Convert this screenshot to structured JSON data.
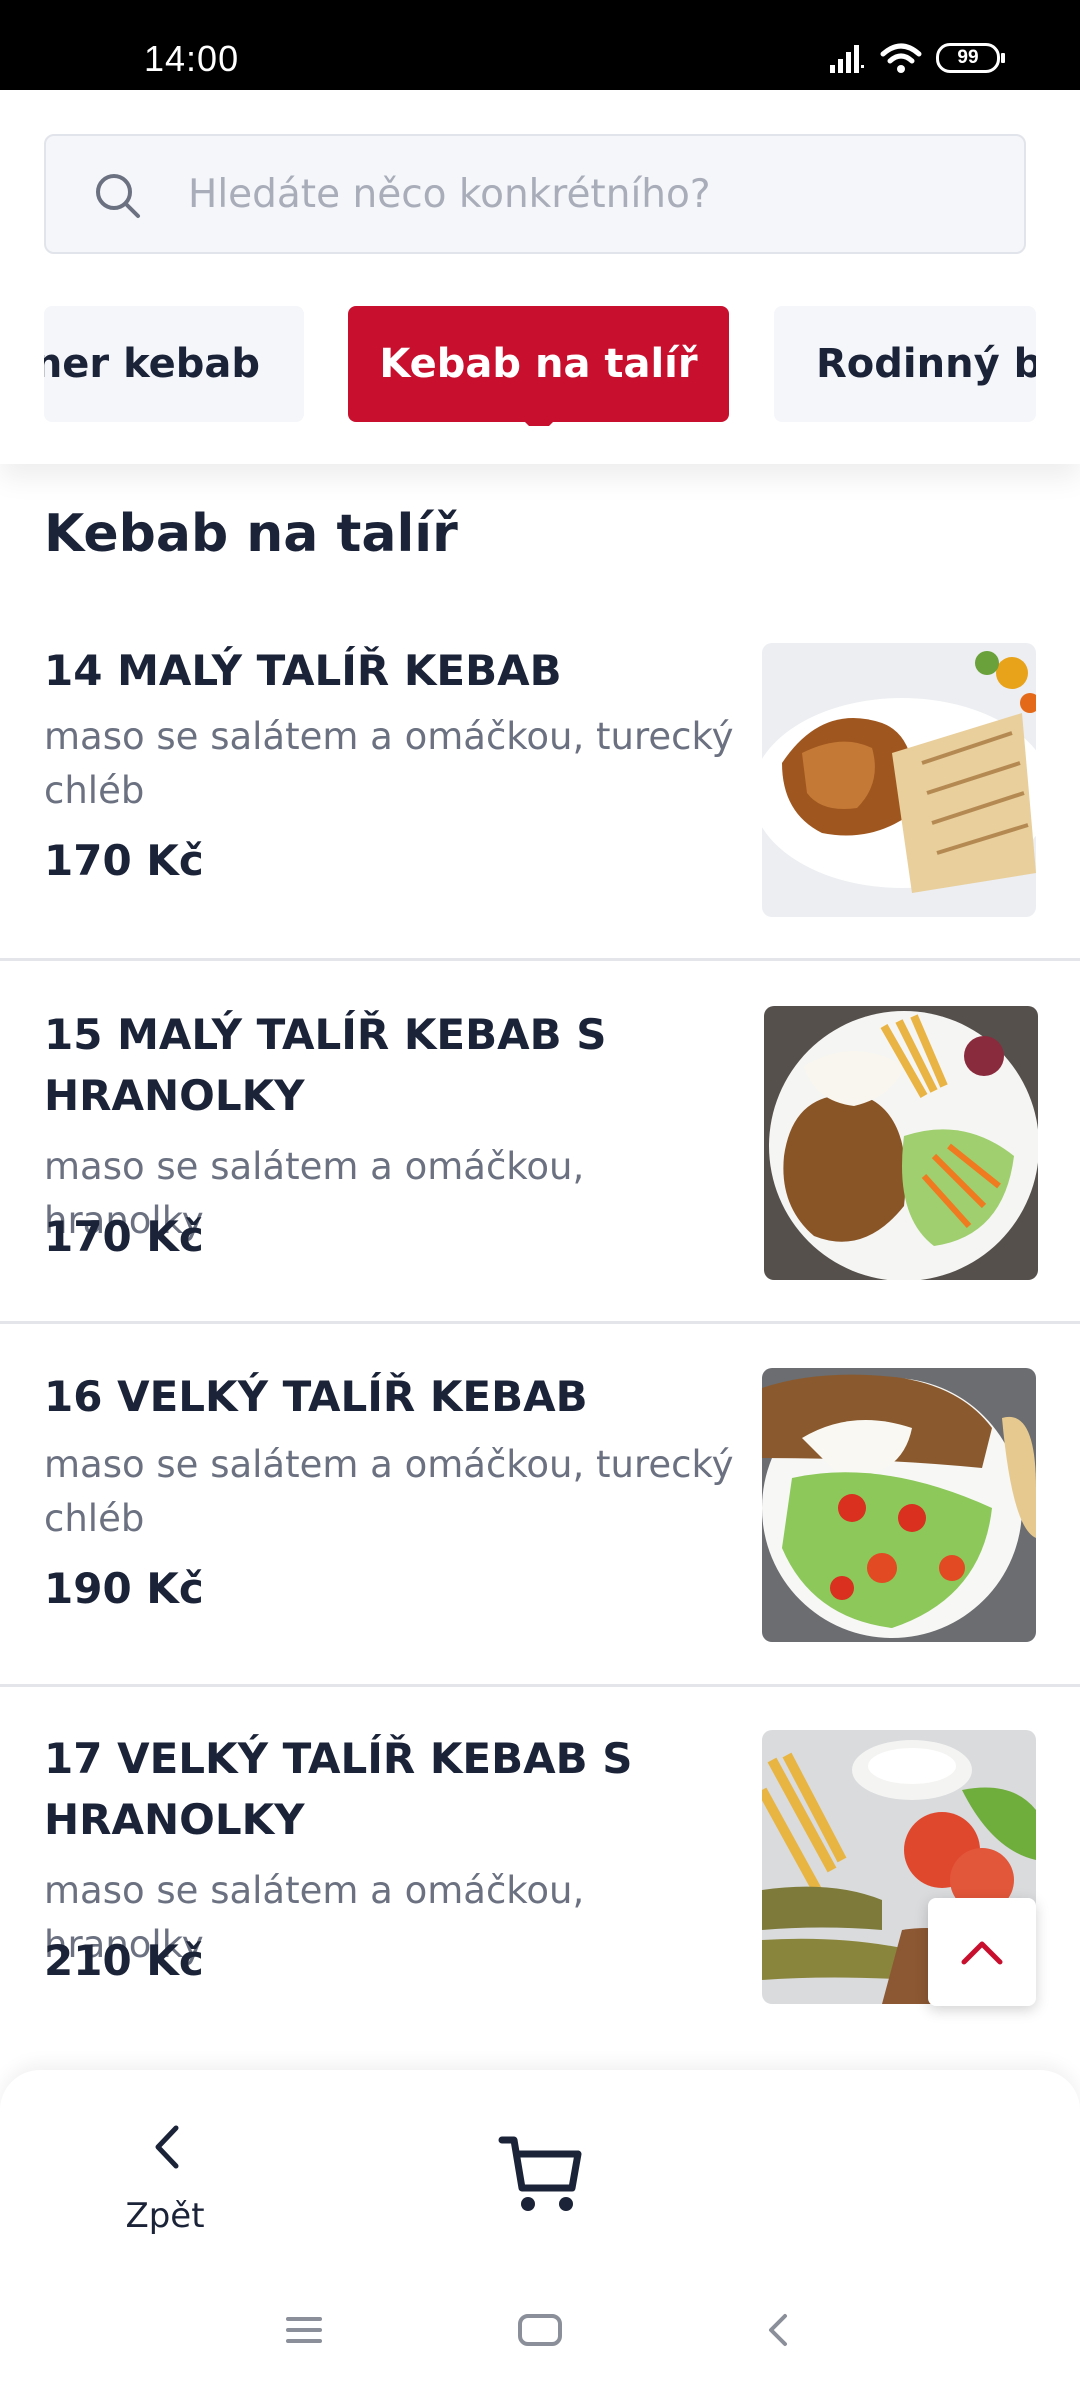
{
  "status_bar": {
    "time": "14:00",
    "battery": "99"
  },
  "search": {
    "placeholder": "Hledáte něco konkrétního?"
  },
  "tabs": [
    {
      "label": "ner kebab",
      "active": false
    },
    {
      "label": "Kebab na talíř",
      "active": true
    },
    {
      "label": "Rodinný bo",
      "active": false
    }
  ],
  "section": {
    "title": "Kebab na talíř"
  },
  "items": [
    {
      "name": "14 MALÝ TALÍŘ KEBAB",
      "description": "maso se salátem a omáčkou, turecký chléb",
      "price": "170 Kč"
    },
    {
      "name": "15 MALÝ TALÍŘ KEBAB S HRANOLKY",
      "description": "maso se salátem a omáčkou, hranolky",
      "price": "170 Kč"
    },
    {
      "name": "16 VELKÝ TALÍŘ KEBAB",
      "description": "maso se salátem a omáčkou, turecký chléb",
      "price": "190 Kč"
    },
    {
      "name": "17 VELKÝ TALÍŘ KEBAB S HRANOLKY",
      "description": "maso se salátem a omáčkou, hranolky",
      "price": "210 Kč"
    }
  ],
  "bottom_bar": {
    "back_label": "Zpět"
  },
  "colors": {
    "accent": "#c8102e",
    "text": "#1b2338",
    "muted": "#6b7180"
  }
}
